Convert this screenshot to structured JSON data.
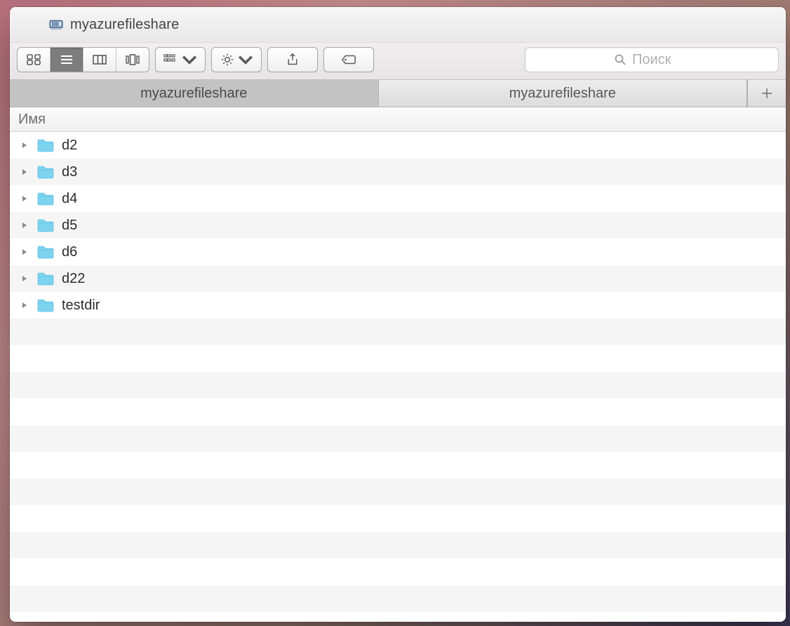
{
  "window": {
    "title": "myazurefileshare"
  },
  "search": {
    "placeholder": "Поиск"
  },
  "tabs": [
    {
      "label": "myazurefileshare",
      "active": true
    },
    {
      "label": "myazurefileshare",
      "active": false
    }
  ],
  "columns": {
    "name_header": "Имя"
  },
  "items": [
    {
      "name": "d2"
    },
    {
      "name": "d3"
    },
    {
      "name": "d4"
    },
    {
      "name": "d5"
    },
    {
      "name": "d6"
    },
    {
      "name": "d22"
    },
    {
      "name": "testdir"
    }
  ]
}
